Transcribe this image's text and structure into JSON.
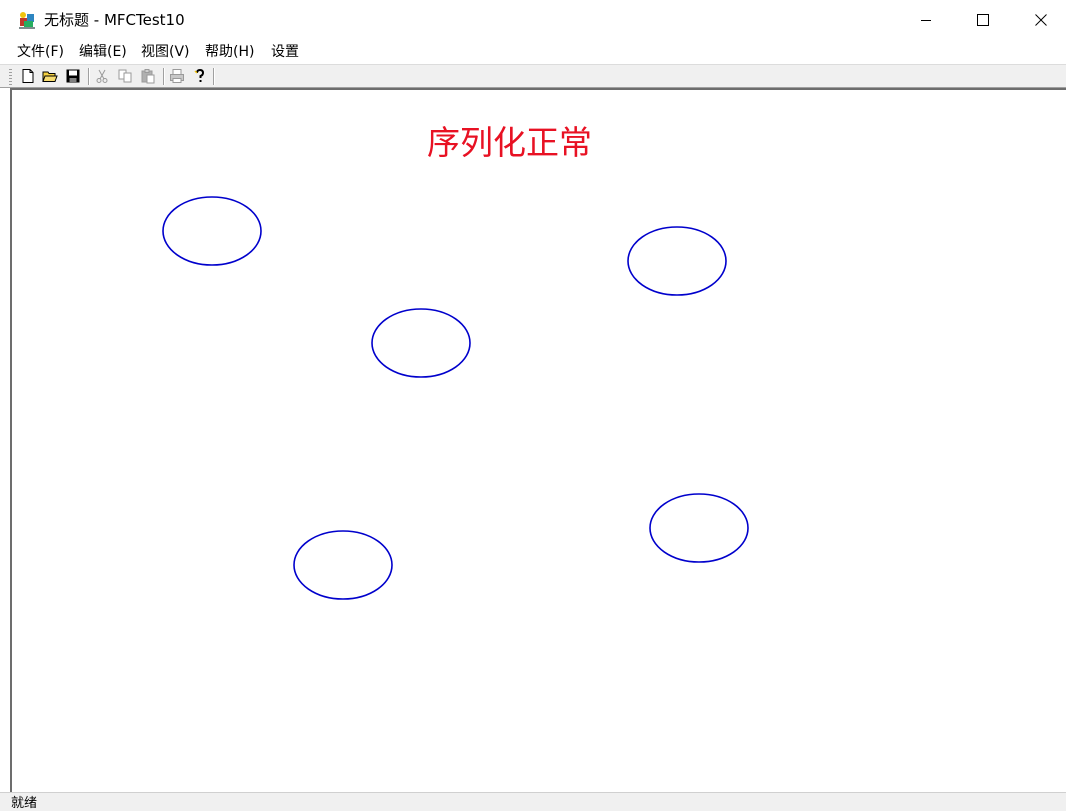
{
  "window": {
    "title": "无标题 - MFCTest10",
    "app_icon": "mfc-app-icon",
    "controls": [
      "minimize-icon",
      "maximize-icon",
      "close-icon"
    ]
  },
  "menu": {
    "items": [
      "文件(F)",
      "编辑(E)",
      "视图(V)",
      "帮助(H)",
      "设置"
    ]
  },
  "toolbar": {
    "buttons": [
      {
        "icon": "new-file-icon",
        "enabled": true
      },
      {
        "icon": "open-folder-icon",
        "enabled": true
      },
      {
        "icon": "save-icon",
        "enabled": true
      },
      {
        "icon": "cut-icon",
        "enabled": false
      },
      {
        "icon": "copy-icon",
        "enabled": false
      },
      {
        "icon": "paste-icon",
        "enabled": false
      },
      {
        "icon": "print-icon",
        "enabled": false
      },
      {
        "icon": "help-icon",
        "enabled": true
      }
    ]
  },
  "canvas": {
    "message": "序列化正常",
    "message_color": "#e81123",
    "ellipse_color": "#0000cc",
    "ellipse_count": 5
  },
  "statusbar": {
    "text": "就绪"
  }
}
